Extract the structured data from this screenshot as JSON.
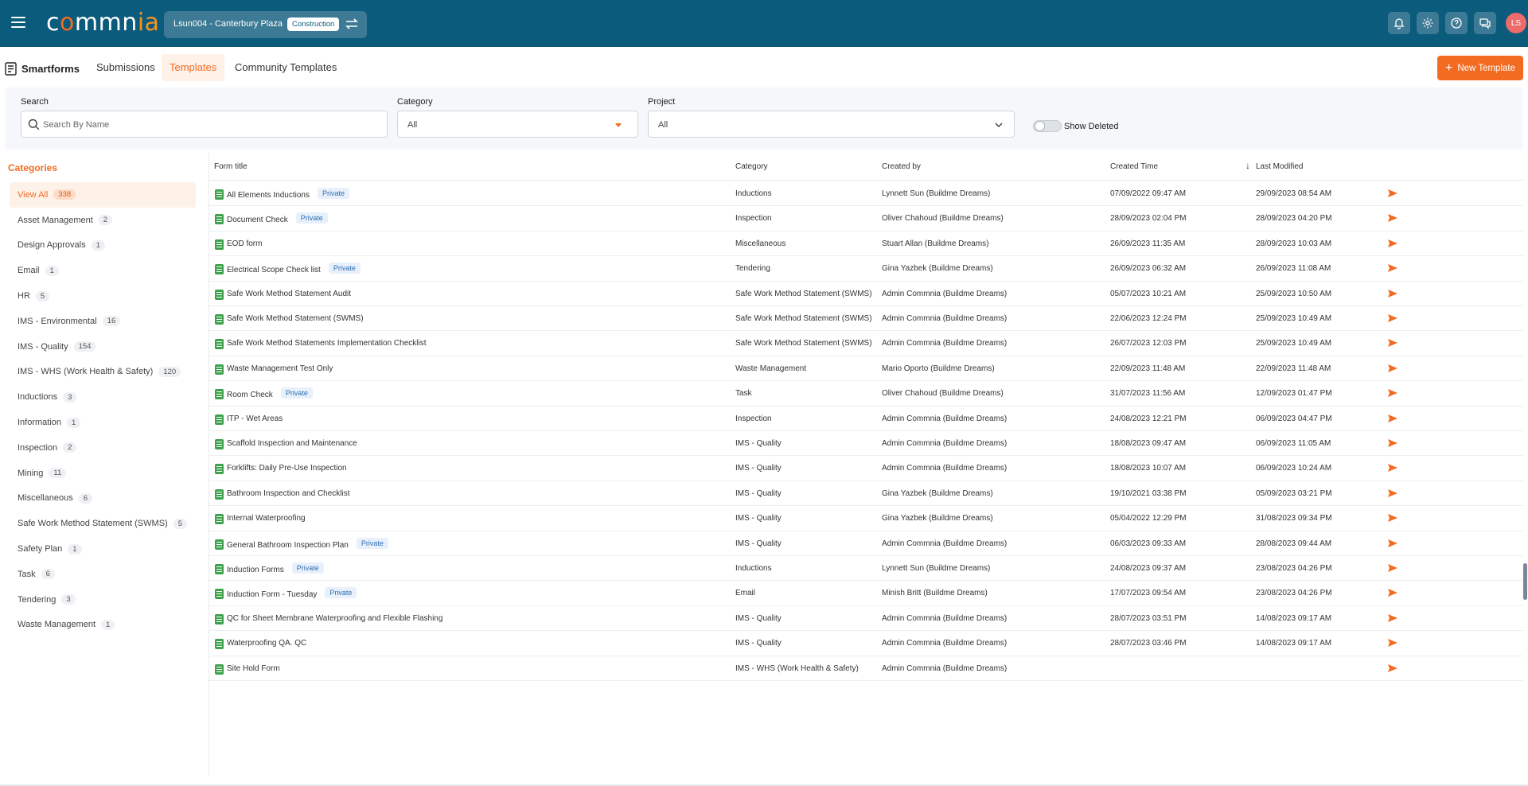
{
  "topbar": {
    "logo": {
      "part1": "c",
      "o": "o",
      "part2": "mmn",
      "tail": "ia"
    },
    "project_name": "Lsun004 - Canterbury Plaza",
    "project_badge": "Construction",
    "avatar_initials": "LS",
    "icons": [
      "bell-icon",
      "gear-icon",
      "help-icon",
      "chat-icon"
    ]
  },
  "subheader": {
    "title": "Smartforms",
    "tabs": [
      "Submissions",
      "Templates",
      "Community Templates"
    ],
    "active_tab": "Templates",
    "new_template_label": "New Template"
  },
  "filters": {
    "search_label": "Search",
    "search_placeholder": "Search By Name",
    "category_label": "Category",
    "category_value": "All",
    "project_label": "Project",
    "project_value": "All",
    "show_deleted_label": "Show Deleted",
    "show_deleted": false
  },
  "sidebar": {
    "title": "Categories",
    "items": [
      {
        "label": "View All",
        "count": "338",
        "active": true
      },
      {
        "label": "Asset Management",
        "count": "2"
      },
      {
        "label": "Design Approvals",
        "count": "1"
      },
      {
        "label": "Email",
        "count": "1"
      },
      {
        "label": "HR",
        "count": "5"
      },
      {
        "label": "IMS - Environmental",
        "count": "16"
      },
      {
        "label": "IMS - Quality",
        "count": "154"
      },
      {
        "label": "IMS - WHS (Work Health & Safety)",
        "count": "120"
      },
      {
        "label": "Inductions",
        "count": "3"
      },
      {
        "label": "Information",
        "count": "1"
      },
      {
        "label": "Inspection",
        "count": "2"
      },
      {
        "label": "Mining",
        "count": "11"
      },
      {
        "label": "Miscellaneous",
        "count": "6"
      },
      {
        "label": "Safe Work Method Statement (SWMS)",
        "count": "5"
      },
      {
        "label": "Safety Plan",
        "count": "1"
      },
      {
        "label": "Task",
        "count": "6"
      },
      {
        "label": "Tendering",
        "count": "3"
      },
      {
        "label": "Waste Management",
        "count": "1"
      }
    ]
  },
  "table": {
    "headers": [
      "Form title",
      "Category",
      "Created by",
      "Created Time",
      "Last Modified"
    ],
    "private_label": "Private",
    "rows": [
      {
        "title": "All Elements Inductions",
        "private": true,
        "category": "Inductions",
        "created_by": "Lynnett Sun (Buildme Dreams)",
        "created": "07/09/2022 09:47 AM",
        "modified": "29/09/2023 08:54 AM"
      },
      {
        "title": "Document Check",
        "private": true,
        "category": "Inspection",
        "created_by": "Oliver Chahoud (Buildme Dreams)",
        "created": "28/09/2023 02:04 PM",
        "modified": "28/09/2023 04:20 PM"
      },
      {
        "title": "EOD form",
        "private": false,
        "category": "Miscellaneous",
        "created_by": "Stuart Allan (Buildme Dreams)",
        "created": "26/09/2023 11:35 AM",
        "modified": "28/09/2023 10:03 AM"
      },
      {
        "title": "Electrical Scope Check list",
        "private": true,
        "category": "Tendering",
        "created_by": "Gina Yazbek (Buildme Dreams)",
        "created": "26/09/2023 06:32 AM",
        "modified": "26/09/2023 11:08 AM"
      },
      {
        "title": "Safe Work Method Statement Audit",
        "private": false,
        "category": "Safe Work Method Statement (SWMS)",
        "created_by": "Admin Commnia (Buildme Dreams)",
        "created": "05/07/2023 10:21 AM",
        "modified": "25/09/2023 10:50 AM"
      },
      {
        "title": "Safe Work Method Statement (SWMS)",
        "private": false,
        "category": "Safe Work Method Statement (SWMS)",
        "created_by": "Admin Commnia (Buildme Dreams)",
        "created": "22/06/2023 12:24 PM",
        "modified": "25/09/2023 10:49 AM"
      },
      {
        "title": "Safe Work Method Statements Implementation Checklist",
        "private": false,
        "category": "Safe Work Method Statement (SWMS)",
        "created_by": "Admin Commnia (Buildme Dreams)",
        "created": "26/07/2023 12:03 PM",
        "modified": "25/09/2023 10:49 AM"
      },
      {
        "title": "Waste Management Test Only",
        "private": false,
        "category": "Waste Management",
        "created_by": "Mario Oporto (Buildme Dreams)",
        "created": "22/09/2023 11:48 AM",
        "modified": "22/09/2023 11:48 AM"
      },
      {
        "title": "Room Check",
        "private": true,
        "category": "Task",
        "created_by": "Oliver Chahoud (Buildme Dreams)",
        "created": "31/07/2023 11:56 AM",
        "modified": "12/09/2023 01:47 PM"
      },
      {
        "title": "ITP - Wet Areas",
        "private": false,
        "category": "Inspection",
        "created_by": "Admin Commnia (Buildme Dreams)",
        "created": "24/08/2023 12:21 PM",
        "modified": "06/09/2023 04:47 PM"
      },
      {
        "title": "Scaffold Inspection and Maintenance",
        "private": false,
        "category": "IMS - Quality",
        "created_by": "Admin Commnia (Buildme Dreams)",
        "created": "18/08/2023 09:47 AM",
        "modified": "06/09/2023 11:05 AM"
      },
      {
        "title": "Forklifts: Daily Pre-Use Inspection",
        "private": false,
        "category": "IMS - Quality",
        "created_by": "Admin Commnia (Buildme Dreams)",
        "created": "18/08/2023 10:07 AM",
        "modified": "06/09/2023 10:24 AM"
      },
      {
        "title": "Bathroom Inspection and Checklist",
        "private": false,
        "category": "IMS - Quality",
        "created_by": "Gina Yazbek (Buildme Dreams)",
        "created": "19/10/2021 03:38 PM",
        "modified": "05/09/2023 03:21 PM"
      },
      {
        "title": "Internal Waterproofing",
        "private": false,
        "category": "IMS - Quality",
        "created_by": "Gina Yazbek (Buildme Dreams)",
        "created": "05/04/2022 12:29 PM",
        "modified": "31/08/2023 09:34 PM"
      },
      {
        "title": "General Bathroom Inspection Plan",
        "private": true,
        "category": "IMS - Quality",
        "created_by": "Admin Commnia (Buildme Dreams)",
        "created": "06/03/2023 09:33 AM",
        "modified": "28/08/2023 09:44 AM"
      },
      {
        "title": "Induction Forms",
        "private": true,
        "category": "Inductions",
        "created_by": "Lynnett Sun (Buildme Dreams)",
        "created": "24/08/2023 09:37 AM",
        "modified": "23/08/2023 04:26 PM"
      },
      {
        "title": "Induction Form - Tuesday",
        "private": true,
        "category": "Email",
        "created_by": "Minish Britt (Buildme Dreams)",
        "created": "17/07/2023 09:54 AM",
        "modified": "23/08/2023 04:26 PM"
      },
      {
        "title": "QC for Sheet Membrane Waterproofing and Flexible Flashing",
        "private": false,
        "category": "IMS - Quality",
        "created_by": "Admin Commnia (Buildme Dreams)",
        "created": "28/07/2023 03:51 PM",
        "modified": "14/08/2023 09:17 AM"
      },
      {
        "title": "Waterproofing QA. QC",
        "private": false,
        "category": "IMS - Quality",
        "created_by": "Admin Commnia (Buildme Dreams)",
        "created": "28/07/2023 03:46 PM",
        "modified": "14/08/2023 09:17 AM"
      },
      {
        "title": "Site Hold Form",
        "private": false,
        "category": "IMS - WHS (Work Health & Safety)",
        "created_by": "Admin Commnia (Buildme Dreams)",
        "created": "",
        "modified": ""
      }
    ]
  },
  "colors": {
    "brand_dark": "#0b5b7c",
    "accent": "#f26b21",
    "form_icon": "#3ea14b"
  }
}
